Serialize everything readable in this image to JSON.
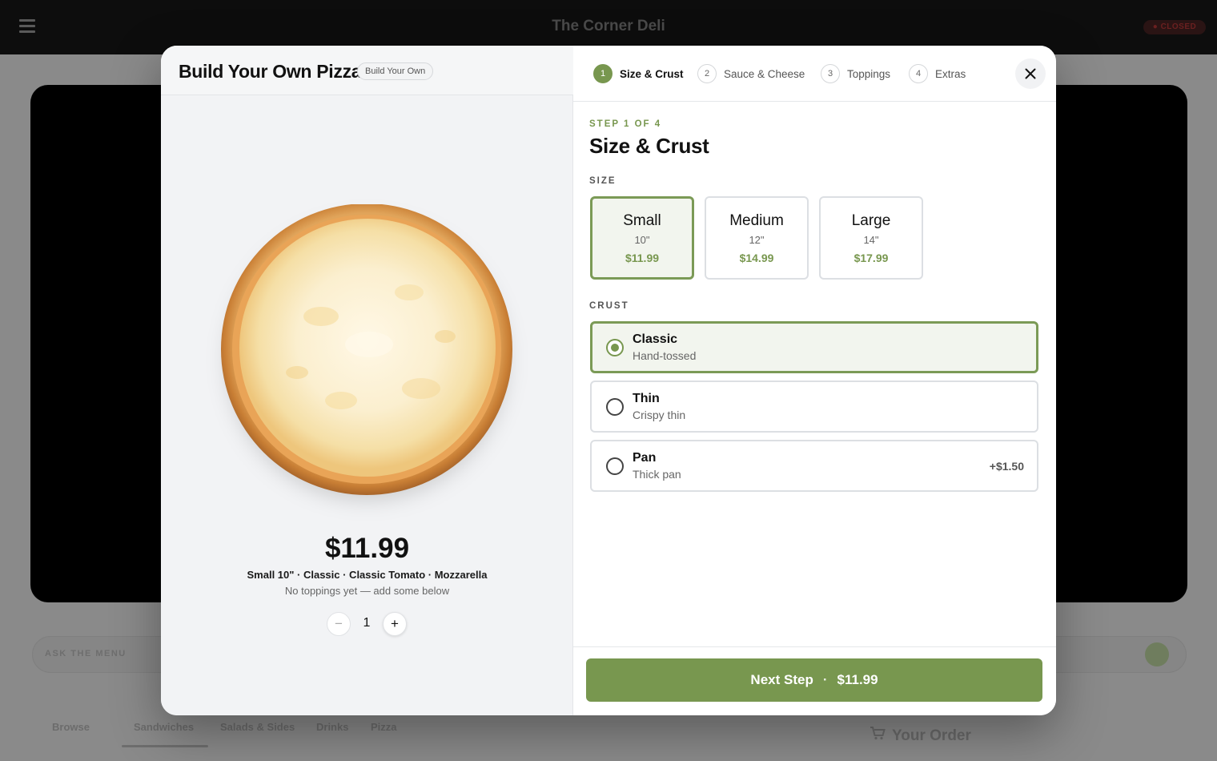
{
  "background": {
    "store_name": "The Corner Deli",
    "status_badge": "● CLOSED",
    "ask_label": "ASK THE MENU",
    "tabs": [
      "Browse",
      "Sandwiches",
      "Salads & Sides",
      "Drinks",
      "Pizza"
    ],
    "order_title": "Your Order"
  },
  "modal": {
    "title": "Build Your Own Pizza",
    "badge": "Build Your Own",
    "preview": {
      "image_icon": "cheese-pizza-image",
      "price": "$11.99",
      "summary": "Small 10\" · Classic · Classic Tomato · Mozzarella",
      "toppings_note": "No toppings yet — add some below",
      "quantity": "1",
      "minus_label": "−",
      "plus_label": "+"
    },
    "steps": [
      {
        "num": "1",
        "label": "Size & Crust",
        "active": true
      },
      {
        "num": "2",
        "label": "Sauce & Cheese",
        "active": false
      },
      {
        "num": "3",
        "label": "Toppings",
        "active": false
      },
      {
        "num": "4",
        "label": "Extras",
        "active": false
      }
    ],
    "close_icon": "close-icon",
    "step_kicker": "STEP 1 OF 4",
    "step_title": "Size & Crust",
    "size_label": "SIZE",
    "sizes": [
      {
        "name": "Small",
        "inches": "10\"",
        "price": "$11.99",
        "selected": true
      },
      {
        "name": "Medium",
        "inches": "12\"",
        "price": "$14.99",
        "selected": false
      },
      {
        "name": "Large",
        "inches": "14\"",
        "price": "$17.99",
        "selected": false
      }
    ],
    "crust_label": "CRUST",
    "crusts": [
      {
        "name": "Classic",
        "desc": "Hand-tossed",
        "extra": "",
        "selected": true
      },
      {
        "name": "Thin",
        "desc": "Crispy thin",
        "extra": "",
        "selected": false
      },
      {
        "name": "Pan",
        "desc": "Thick pan",
        "extra": "+$1.50",
        "selected": false
      }
    ],
    "next_button": {
      "label": "Next Step",
      "separator": "·",
      "price": "$11.99"
    }
  },
  "colors": {
    "accent": "#78974f",
    "accent_light": "#f2f5ee",
    "overlay": "#8a8a8a"
  }
}
